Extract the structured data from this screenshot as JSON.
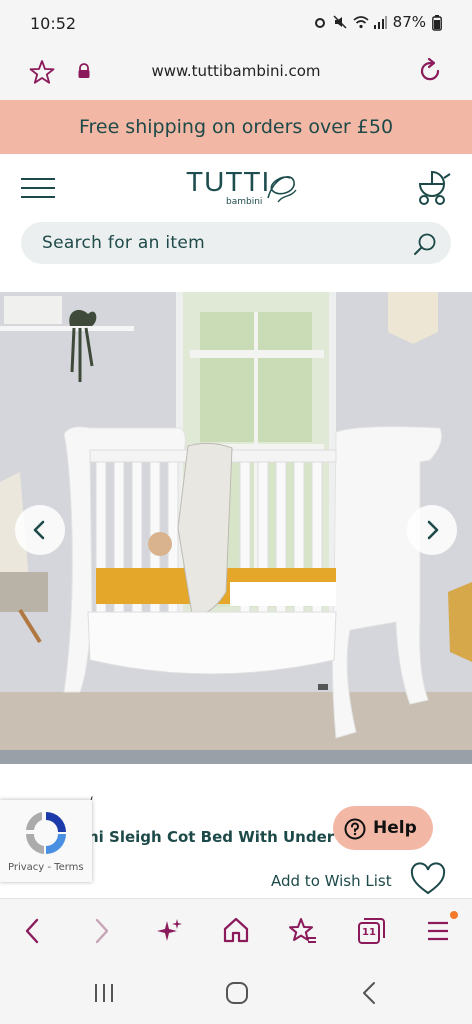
{
  "status": {
    "time": "10:52",
    "battery": "87%"
  },
  "browser": {
    "url": "www.tuttibambini.com"
  },
  "promo": {
    "text": "Free shipping on orders over £50"
  },
  "header": {
    "logo": "TUTTI",
    "logo_sub": "bambini"
  },
  "search": {
    "placeholder": "Search for an item"
  },
  "product": {
    "title_fragment": "ni Sleigh Cot Bed With Under Be",
    "partial_text": "/",
    "wishlist_label": "Add to Wish List"
  },
  "help": {
    "label": "Help"
  },
  "recaptcha": {
    "label": "Privacy - Terms"
  },
  "toolbar": {
    "tabs_count": "11"
  },
  "colors": {
    "brand": "#1d4a49",
    "promo_bg": "#f3b8a5",
    "accent": "#8b1a5b"
  }
}
